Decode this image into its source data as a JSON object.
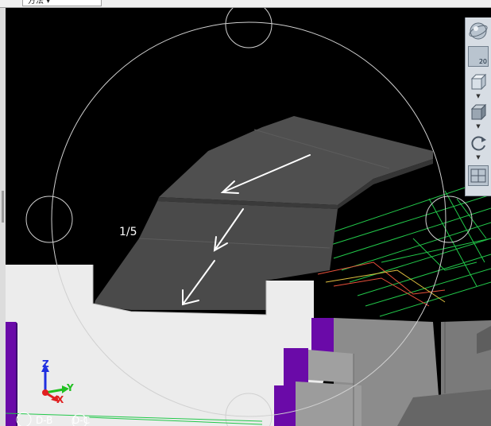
{
  "toolbar": {
    "dropdown_text": "方法 ▾"
  },
  "viewport": {
    "level_label": "1/5",
    "ucs": {
      "x": "X",
      "y": "Y",
      "z": "Z"
    },
    "cad_text": [
      "D-B",
      "D-C"
    ]
  },
  "navbar": {
    "zoom_value": "20",
    "items": [
      {
        "name": "steering-wheel-icon"
      },
      {
        "name": "zoom-icon"
      },
      {
        "name": "view-cube-icon"
      },
      {
        "name": "shaded-cube-icon"
      },
      {
        "name": "orbit-icon"
      },
      {
        "name": "layout-icon"
      }
    ]
  },
  "colors": {
    "background": "#000000",
    "wall": "#ececec",
    "ramp": "#4a4a4a",
    "cad_green": "#22c84a",
    "purple": "#6a0aa8",
    "column_gray": "#8c8c8c"
  }
}
